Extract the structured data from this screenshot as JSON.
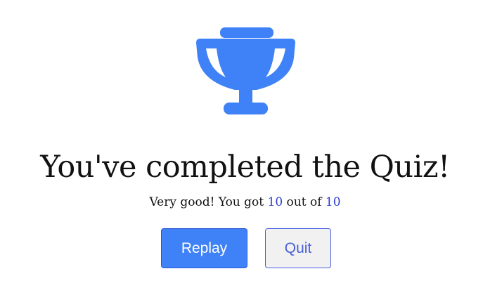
{
  "icon": {
    "name": "trophy-icon",
    "color": "#3f81f6"
  },
  "result": {
    "heading": "You've completed the Quiz!",
    "score_prefix": "Very good! You got ",
    "score": "10",
    "score_middle": " out of ",
    "total": "10"
  },
  "buttons": {
    "replay_label": "Replay",
    "quit_label": "Quit"
  },
  "colors": {
    "primary": "#3f81f6",
    "number_accent": "#2a3bd6",
    "secondary_bg": "#f1f1f1"
  }
}
